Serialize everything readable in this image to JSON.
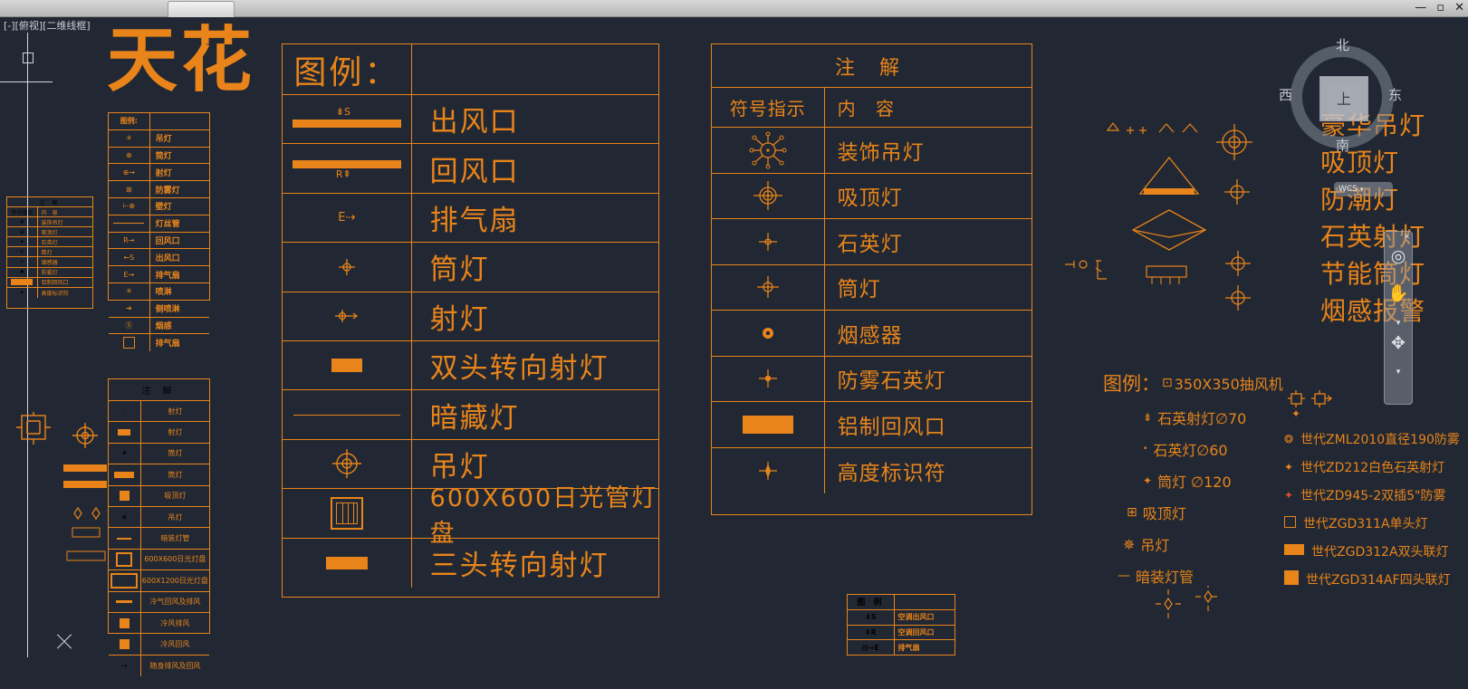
{
  "window": {
    "tab_label": "",
    "controls": [
      "—",
      "▫",
      "✕"
    ]
  },
  "viewport": {
    "label": "[-][俯视][二维线框]"
  },
  "canvas": {
    "big_title": "天花",
    "accent_color": "#e8841a",
    "background_color": "#222833"
  },
  "main_legend": {
    "title": "图例：",
    "rows": [
      {
        "symbol": "supply-air-vent",
        "tag": "S",
        "label": "出风口"
      },
      {
        "symbol": "return-air-vent",
        "tag": "R",
        "label": "回风口"
      },
      {
        "symbol": "exhaust-fan",
        "tag": "E",
        "label": "排气扇"
      },
      {
        "symbol": "downlight",
        "tag": "",
        "label": "筒灯"
      },
      {
        "symbol": "spotlight",
        "tag": "",
        "label": "射灯"
      },
      {
        "symbol": "double-head-track-spotlight",
        "tag": "",
        "label": "双头转向射灯"
      },
      {
        "symbol": "cove-light-line",
        "tag": "",
        "label": "暗藏灯"
      },
      {
        "symbol": "pendant-light",
        "tag": "",
        "label": "吊灯"
      },
      {
        "symbol": "fluorescent-panel",
        "tag": "",
        "label": "600X600日光管灯盘"
      },
      {
        "symbol": "triple-head-track-spotlight",
        "tag": "",
        "label": "三头转向射灯"
      }
    ]
  },
  "note_table": {
    "title": "注    解",
    "col_symbol": "符号指示",
    "col_content": "内    容",
    "rows": [
      {
        "symbol": "decorative-pendant",
        "label": "装饰吊灯"
      },
      {
        "symbol": "ceiling-light",
        "label": "吸顶灯"
      },
      {
        "symbol": "quartz-light",
        "label": "石英灯"
      },
      {
        "symbol": "downlight",
        "label": "筒灯"
      },
      {
        "symbol": "smoke-detector",
        "label": "烟感器"
      },
      {
        "symbol": "fogproof-quartz-light",
        "label": "防雾石英灯"
      },
      {
        "symbol": "aluminium-return-vent",
        "label": "铝制回风口"
      },
      {
        "symbol": "height-marker",
        "label": "高度标识符"
      }
    ]
  },
  "small_legend": {
    "title": "图例:",
    "rows": [
      {
        "symbol": "pendant-light",
        "label": "吊灯"
      },
      {
        "symbol": "downlight",
        "label": "筒灯"
      },
      {
        "symbol": "spotlight",
        "label": "射灯"
      },
      {
        "symbol": "fogproof-light",
        "label": "防雾灯"
      },
      {
        "symbol": "wall-light",
        "label": "壁灯"
      },
      {
        "symbol": "filament-tube",
        "label": "灯丝管"
      },
      {
        "symbol": "return-air-vent",
        "tag": "R",
        "label": "回风口"
      },
      {
        "symbol": "supply-air-vent",
        "tag": "S",
        "label": "出风口"
      },
      {
        "symbol": "exhaust-fan",
        "tag": "E",
        "label": "排气扇"
      },
      {
        "symbol": "sprinkler",
        "label": "喷淋"
      },
      {
        "symbol": "side-sprinkler",
        "label": "侧喷淋"
      },
      {
        "symbol": "smoke-detector",
        "label": "烟感"
      },
      {
        "symbol": "exhaust-fan-box",
        "label": "排气扇"
      }
    ]
  },
  "small_note": {
    "title": "注 解",
    "rows": [
      {
        "symbol": "spotlight-dot",
        "label": "射灯"
      },
      {
        "symbol": "spotlight-bar",
        "label": "射灯"
      },
      {
        "symbol": "downlight",
        "label": "筒灯"
      },
      {
        "symbol": "downlight-strip",
        "label": "筒灯"
      },
      {
        "symbol": "ceiling-light",
        "label": "吸顶灯"
      },
      {
        "symbol": "pendant-light",
        "label": "吊灯"
      },
      {
        "symbol": "concealed-tube",
        "label": "暗装灯管"
      },
      {
        "symbol": "panel-600x600",
        "label": "600X600日光灯盘"
      },
      {
        "symbol": "panel-600x1200",
        "label": "600X1200日光灯盘"
      },
      {
        "symbol": "ac-return-exhaust",
        "label": "冷气回风及排风"
      },
      {
        "symbol": "ac-exhaust",
        "label": "冷风排风"
      },
      {
        "symbol": "ac-return",
        "label": "冷风回风"
      },
      {
        "symbol": "toilet-exhaust-return",
        "label": "随身排风及回风"
      }
    ]
  },
  "micro_note": {
    "title": "注    解",
    "col_symbol": "符号指示",
    "col_content": "内  容",
    "rows": [
      {
        "label": "装饰吊灯"
      },
      {
        "label": "吸顶灯"
      },
      {
        "label": "石英灯"
      },
      {
        "label": "筒灯"
      },
      {
        "label": "烟感器"
      },
      {
        "label": "防雾灯"
      },
      {
        "label": "铝制回风口"
      },
      {
        "label": "高度标识符"
      }
    ]
  },
  "bottom_legend": {
    "title": "图  例",
    "rows": [
      {
        "tag": "S",
        "label": "空调出风口"
      },
      {
        "tag": "R",
        "label": "空调回风口"
      },
      {
        "tag": "E",
        "label": "排气扇"
      }
    ]
  },
  "right_legend": {
    "title": "图例：",
    "head_item": "350X350抽风机",
    "items": [
      "石英射灯∅70",
      "石英灯∅60",
      "筒灯 ∅120",
      "吸顶灯",
      "吊灯",
      "暗装灯管"
    ]
  },
  "far_right_list": {
    "items": [
      "世代ZML2010直径190防雾",
      "世代ZD212白色石英射灯",
      "世代ZD945-2双插5\"防雾",
      "世代ZGD311A单头灯",
      "世代ZGD312A双头联灯",
      "世代ZGD314AF四头联灯"
    ]
  },
  "right_words": {
    "items": [
      "豪华吊灯",
      "吸顶灯",
      "防潮灯",
      "石英射灯",
      "节能筒灯",
      "烟感报警"
    ]
  },
  "viewcube": {
    "north": "北",
    "south": "南",
    "west": "西",
    "east": "东",
    "top": "上",
    "wcs_label": "WCS"
  },
  "navbar": {
    "close": "✕",
    "icons": [
      "steering-wheel-icon",
      "pan-hand-icon",
      "chevron-down-icon",
      "orbit-icon",
      "chevron-down-icon"
    ]
  }
}
